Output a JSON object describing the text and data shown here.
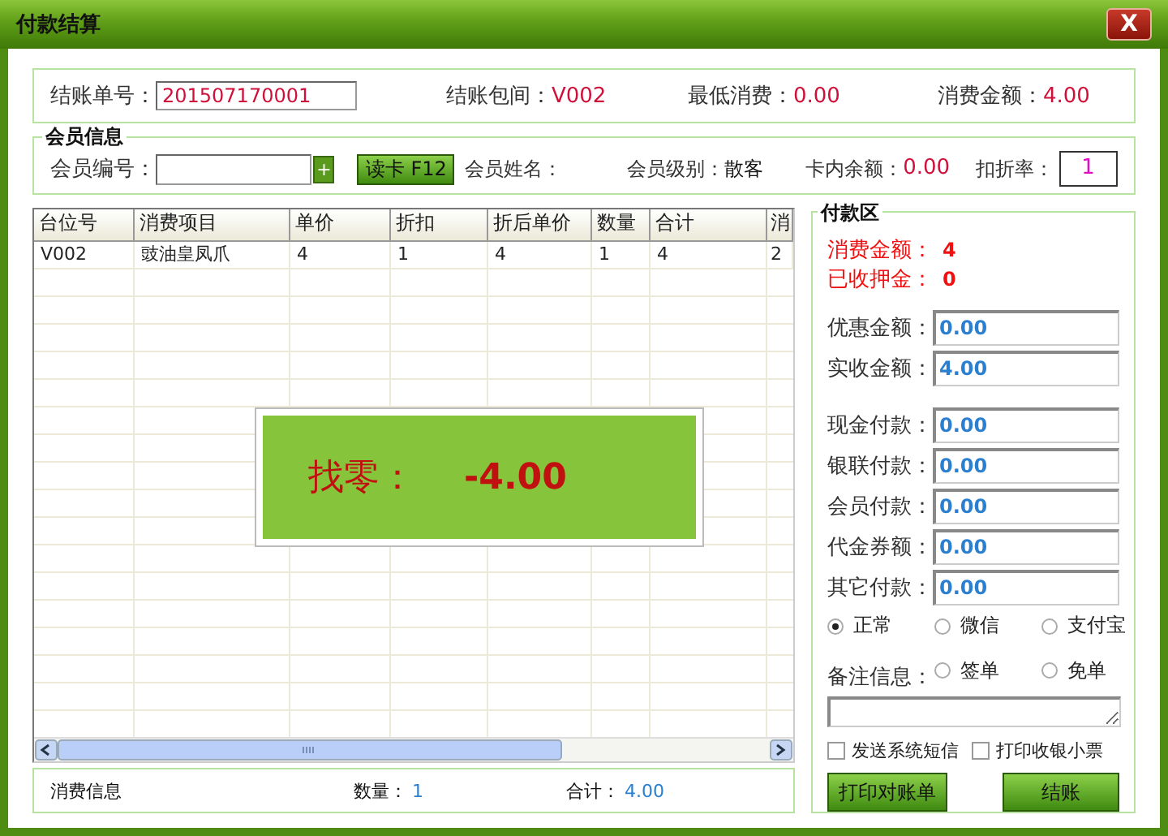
{
  "window": {
    "title": "付款结算",
    "close": "X"
  },
  "bill": [
    {
      "label": "结账单号：",
      "value": "201507170001",
      "kind": "input"
    },
    {
      "label": "结账包间：",
      "value": "V002",
      "kind": "text"
    },
    {
      "label": "最低消费：",
      "value": "0.00",
      "kind": "text"
    },
    {
      "label": "消费金额：",
      "value": "4.00",
      "kind": "text"
    }
  ],
  "member": {
    "legend": "会员信息",
    "id_label": "会员编号：",
    "add": "+",
    "read_card": "读卡 F12",
    "name_label": "会员姓名：",
    "level_label": "会员级别：",
    "level": "散客",
    "balance_label": "卡内余额：",
    "balance": "0.00",
    "rate_label": "扣折率：",
    "rate": "1"
  },
  "table": {
    "columns": [
      "台位号",
      "消费项目",
      "单价",
      "折扣",
      "折后单价",
      "数量",
      "合计",
      "消"
    ],
    "rows": [
      [
        "V002",
        "豉油皇凤爪",
        "4",
        "1",
        "4",
        "1",
        "4",
        "2"
      ]
    ]
  },
  "change": {
    "label": "找零：",
    "value": "-4.00"
  },
  "summary": {
    "title": "消费信息",
    "qty_label": "数量：",
    "qty": "1",
    "total_label": "合计：",
    "total": "4.00"
  },
  "payment": {
    "legend": "付款区",
    "totals": [
      {
        "label": "消费金额：",
        "value": "4"
      },
      {
        "label": "已收押金：",
        "value": "0"
      }
    ],
    "amounts": [
      {
        "label": "优惠金额：",
        "value": "0.00"
      },
      {
        "label": "实收金额：",
        "value": "4.00"
      }
    ],
    "payments": [
      {
        "label": "现金付款：",
        "value": "0.00"
      },
      {
        "label": "银联付款：",
        "value": "0.00"
      },
      {
        "label": "会员付款：",
        "value": "0.00"
      },
      {
        "label": "代金券额：",
        "value": "0.00"
      },
      {
        "label": "其它付款：",
        "value": "0.00"
      }
    ],
    "methods": [
      {
        "label": "正常",
        "selected": true
      },
      {
        "label": "微信",
        "selected": false
      },
      {
        "label": "支付宝",
        "selected": false
      },
      {
        "label": "签单",
        "selected": false
      },
      {
        "label": "免单",
        "selected": false
      }
    ],
    "note_label": "备注信息：",
    "options": [
      {
        "label": "发送系统短信",
        "checked": false
      },
      {
        "label": "打印收银小票",
        "checked": false
      }
    ],
    "buttons": [
      "打印对账单",
      "结账"
    ]
  }
}
